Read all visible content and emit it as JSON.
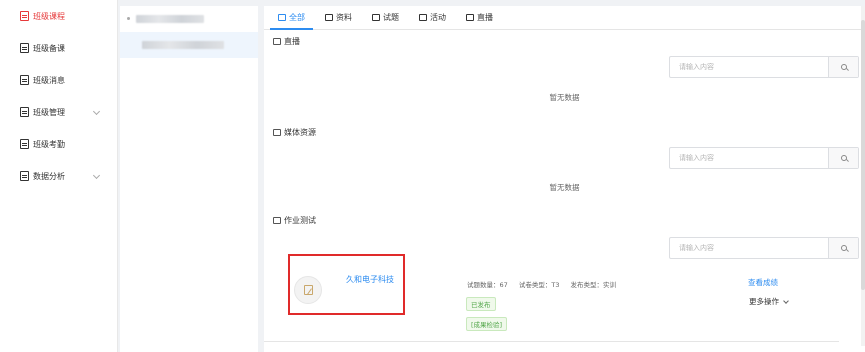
{
  "sidebar": {
    "items": [
      {
        "label": "班级课程",
        "active": true,
        "has_chevron": false
      },
      {
        "label": "班级备课",
        "active": false,
        "has_chevron": false
      },
      {
        "label": "班级消息",
        "active": false,
        "has_chevron": false
      },
      {
        "label": "班级管理",
        "active": false,
        "has_chevron": true
      },
      {
        "label": "班级考勤",
        "active": false,
        "has_chevron": false
      },
      {
        "label": "数据分析",
        "active": false,
        "has_chevron": true
      }
    ]
  },
  "tabs": [
    {
      "label": "全部",
      "active": true
    },
    {
      "label": "资料",
      "active": false
    },
    {
      "label": "试题",
      "active": false
    },
    {
      "label": "活动",
      "active": false
    },
    {
      "label": "直播",
      "active": false
    }
  ],
  "sections": {
    "live": {
      "title": "直播",
      "search_placeholder": "请输入内容",
      "empty_text": "暂无数据"
    },
    "media": {
      "title": "媒体资源",
      "search_placeholder": "请输入内容",
      "empty_text": "暂无数据"
    },
    "homework": {
      "title": "作业测试",
      "search_placeholder": "请输入内容"
    }
  },
  "homework_item": {
    "title": "久和电子科技",
    "question_count": "试题数量：67",
    "paper_type": "试卷类型：T3",
    "publish_type": "发布类型：实训",
    "status_tag": "已发布",
    "category_tag": "[成果检验]",
    "view_scores": "查看成绩",
    "more_actions": "更多操作"
  },
  "colors": {
    "accent": "#2d8cf0",
    "active_sidebar": "#e6393a",
    "highlight_box": "#e02a2a",
    "tag_green": "#52a64a"
  }
}
